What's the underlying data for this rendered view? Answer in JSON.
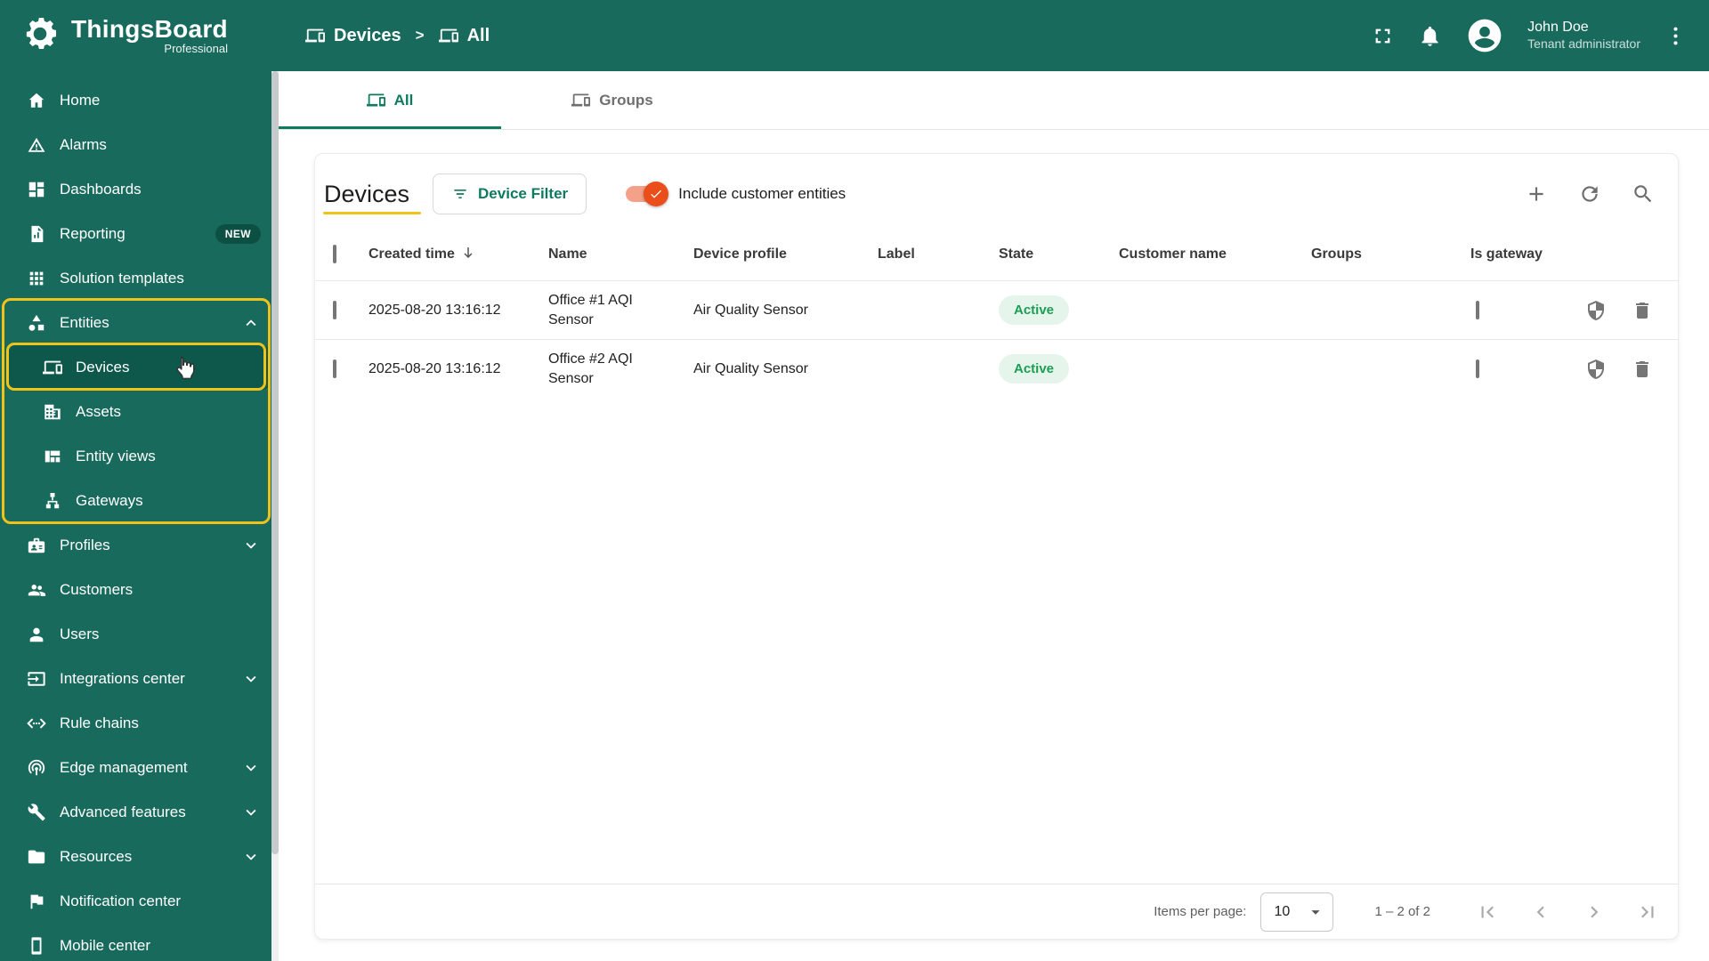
{
  "header": {
    "brand_name": "ThingsBoard",
    "brand_edition": "Professional",
    "breadcrumb": {
      "level1": "Devices",
      "separator": ">",
      "level2": "All"
    },
    "user_name": "John Doe",
    "user_role": "Tenant administrator",
    "icons": [
      "fullscreen-icon",
      "notifications-icon",
      "account-icon",
      "more-menu-icon"
    ]
  },
  "sidebar": {
    "items": [
      {
        "label": "Home",
        "icon": "home-icon"
      },
      {
        "label": "Alarms",
        "icon": "alarm-warning-icon"
      },
      {
        "label": "Dashboards",
        "icon": "dashboards-icon"
      },
      {
        "label": "Reporting",
        "icon": "reporting-icon",
        "badge": "NEW"
      },
      {
        "label": "Solution templates",
        "icon": "solution-templates-icon"
      },
      {
        "label": "Entities",
        "icon": "entities-icon",
        "state": "expanded",
        "highlighted": true
      },
      {
        "label": "Devices",
        "icon": "devices-icon",
        "state": "selected",
        "highlighted": true
      },
      {
        "label": "Assets",
        "icon": "assets-icon"
      },
      {
        "label": "Entity views",
        "icon": "entity-views-icon"
      },
      {
        "label": "Gateways",
        "icon": "gateways-icon"
      },
      {
        "label": "Profiles",
        "icon": "profiles-icon",
        "state": "collapsed"
      },
      {
        "label": "Customers",
        "icon": "customers-icon"
      },
      {
        "label": "Users",
        "icon": "users-icon"
      },
      {
        "label": "Integrations center",
        "icon": "integrations-icon",
        "state": "collapsed"
      },
      {
        "label": "Rule chains",
        "icon": "rule-chains-icon"
      },
      {
        "label": "Edge management",
        "icon": "edge-management-icon",
        "state": "collapsed"
      },
      {
        "label": "Advanced features",
        "icon": "advanced-features-icon",
        "state": "collapsed"
      },
      {
        "label": "Resources",
        "icon": "resources-icon",
        "state": "collapsed"
      },
      {
        "label": "Notification center",
        "icon": "notification-center-icon"
      },
      {
        "label": "Mobile center",
        "icon": "mobile-center-icon"
      }
    ]
  },
  "tabs": {
    "all": "All",
    "groups": "Groups"
  },
  "content": {
    "title": "Devices",
    "filter_button_label": "Device Filter",
    "include_toggle_label": "Include customer entities",
    "toggle_checked": true,
    "columns": [
      "Created time",
      "Name",
      "Device profile",
      "Label",
      "State",
      "Customer name",
      "Groups",
      "Is gateway"
    ],
    "rows": [
      {
        "created_time": "2025-08-20 13:16:12",
        "name": "Office #1 AQI Sensor",
        "device_profile": "Air Quality Sensor",
        "label": "",
        "state": "Active",
        "customer_name": "",
        "groups": "",
        "is_gateway": false
      },
      {
        "created_time": "2025-08-20 13:16:12",
        "name": "Office #2 AQI Sensor",
        "device_profile": "Air Quality Sensor",
        "label": "",
        "state": "Active",
        "customer_name": "",
        "groups": "",
        "is_gateway": false
      }
    ],
    "toolbar_icons": [
      "add-icon",
      "refresh-icon",
      "search-icon"
    ],
    "row_action_icons": [
      "shield-icon",
      "delete-icon"
    ]
  },
  "pagination": {
    "items_per_page_label": "Items per page:",
    "items_per_page": "10",
    "range": "1 – 2 of 2"
  },
  "colors": {
    "primary_green": "#186a5d",
    "selected_item_green": "#0d574b",
    "accent_green": "#0e7a60",
    "highlight_yellow": "#efc319",
    "toggle_orange": "#ea4e1b",
    "active_badge_bg": "#e6f5eb",
    "active_badge_text": "#1b9e54"
  }
}
